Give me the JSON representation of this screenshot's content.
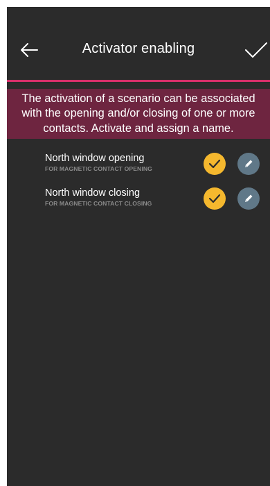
{
  "header": {
    "title": "Activator enabling",
    "back_icon": "arrow-left-icon",
    "confirm_icon": "checkmark-icon"
  },
  "banner": {
    "lines": [
      "The activation of a scenario can be associated",
      "with the opening and/or closing of one or more",
      "contacts. Activate and assign a name."
    ]
  },
  "contacts": [
    {
      "name": "North window opening",
      "subtitle": "FOR MAGNETIC CONTACT OPENING",
      "enabled": true
    },
    {
      "name": "North window closing",
      "subtitle": "FOR MAGNETIC CONTACT CLOSING",
      "enabled": true
    }
  ],
  "colors": {
    "background": "#2b2b2b",
    "accent_line": "#d8306b",
    "banner": "#6e2540",
    "check_badge": "#f5b82e",
    "edit_badge": "#607888",
    "subtitle_text": "#8a8a8a"
  }
}
